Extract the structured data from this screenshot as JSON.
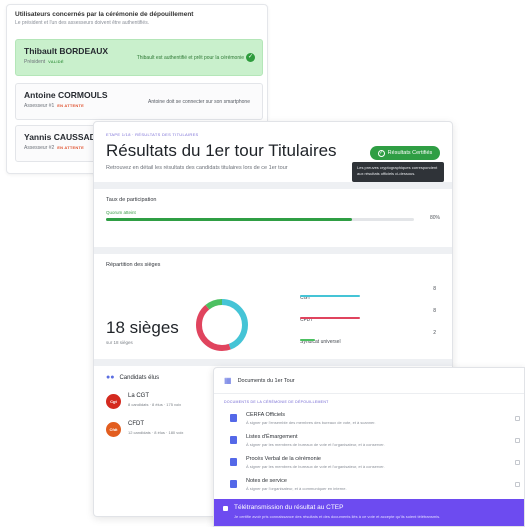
{
  "ceremony": {
    "title": "Utilisateurs concernés par la cérémonie de dépouillement",
    "subtitle": "Le président et l'un des assesseurs doivent être authentifiés.",
    "users": [
      {
        "name": "Thibault BORDEAUX",
        "role": "Président",
        "badge": "VALIDÉ",
        "status": "Thibault est authentifié et prêt pour la cérémonie",
        "state": "validated"
      },
      {
        "name": "Antoine CORMOULS",
        "role": "Assesseur #1",
        "badge": "EN ATTENTE",
        "status": "Antoine doit se connecter sur son smartphone",
        "state": "waiting"
      },
      {
        "name": "Yannis CAUSSADE",
        "role": "Assesseur #2",
        "badge": "EN ATTENTE",
        "status": "",
        "state": "waiting"
      }
    ]
  },
  "results": {
    "breadcrumb": "ETAPE 1/18 · RÉSULTATS DES TITULAIRES",
    "title": "Résultats du 1er tour Titulaires",
    "description": "Retrouvez en détail les résultats des candidats titulaires lors de ce 1er tour",
    "certified_button": "Résultats Certifiés",
    "tooltip": "Les preuves cryptographiques correspondent aux résultats officiels ci-dessous.",
    "participation": {
      "label": "Taux de participation",
      "quorum": "Quorum atteint",
      "rate": 80,
      "rate_label": "80%"
    },
    "seats": {
      "label": "Répartition des sièges",
      "total_label": "18 sièges",
      "sub_label": "sur 18 sièges",
      "colors": {
        "CGT": "#45c4d6",
        "CFDT": "#e0445e",
        "Syndicat universel": "#4cc061"
      },
      "rows": [
        {
          "name": "CGT",
          "count": "8",
          "value": 8
        },
        {
          "name": "CFDT",
          "count": "8",
          "value": 8
        },
        {
          "name": "Syndicat universel",
          "count": "2",
          "value": 2
        }
      ]
    },
    "elected": {
      "label": "Candidats élus",
      "candidates": [
        {
          "name": "La CGT",
          "detail": "8 candidats · 8 élus · 175 voix",
          "logo": "Cgt",
          "color": "#d42a1f"
        },
        {
          "name": "CFDT",
          "detail": "12 candidats · 8 élus · 180 voix",
          "logo": "Cfdt",
          "color": "#e25d1f"
        }
      ]
    }
  },
  "documents": {
    "title": "Documents du 1er Tour",
    "caption": "DOCUMENTS DE LA CÉRÉMONIE DE DÉPOUILLEMENT",
    "items": [
      {
        "name": "CERFA Officiels",
        "desc": "À signer par l'ensemble des membres des bureaux de vote, et à scanner."
      },
      {
        "name": "Listes d'Émargement",
        "desc": "À signer par les membres de bureaux de vote et l'organisateur, et à conserver."
      },
      {
        "name": "Procès Verbal de la cérémonie",
        "desc": "À signer par les membres de bureaux de vote et l'organisateur, et à conserver."
      },
      {
        "name": "Notes de service",
        "desc": "À signer par l'organisateur, et à communiquer en interne."
      }
    ],
    "cta": {
      "title": "Télétransmission du résultat au CTEP",
      "desc": "Je certifie avoir pris connaissance des résultats et des documents liés à ce vote et accepte qu'ils soient télétransmis."
    }
  }
}
